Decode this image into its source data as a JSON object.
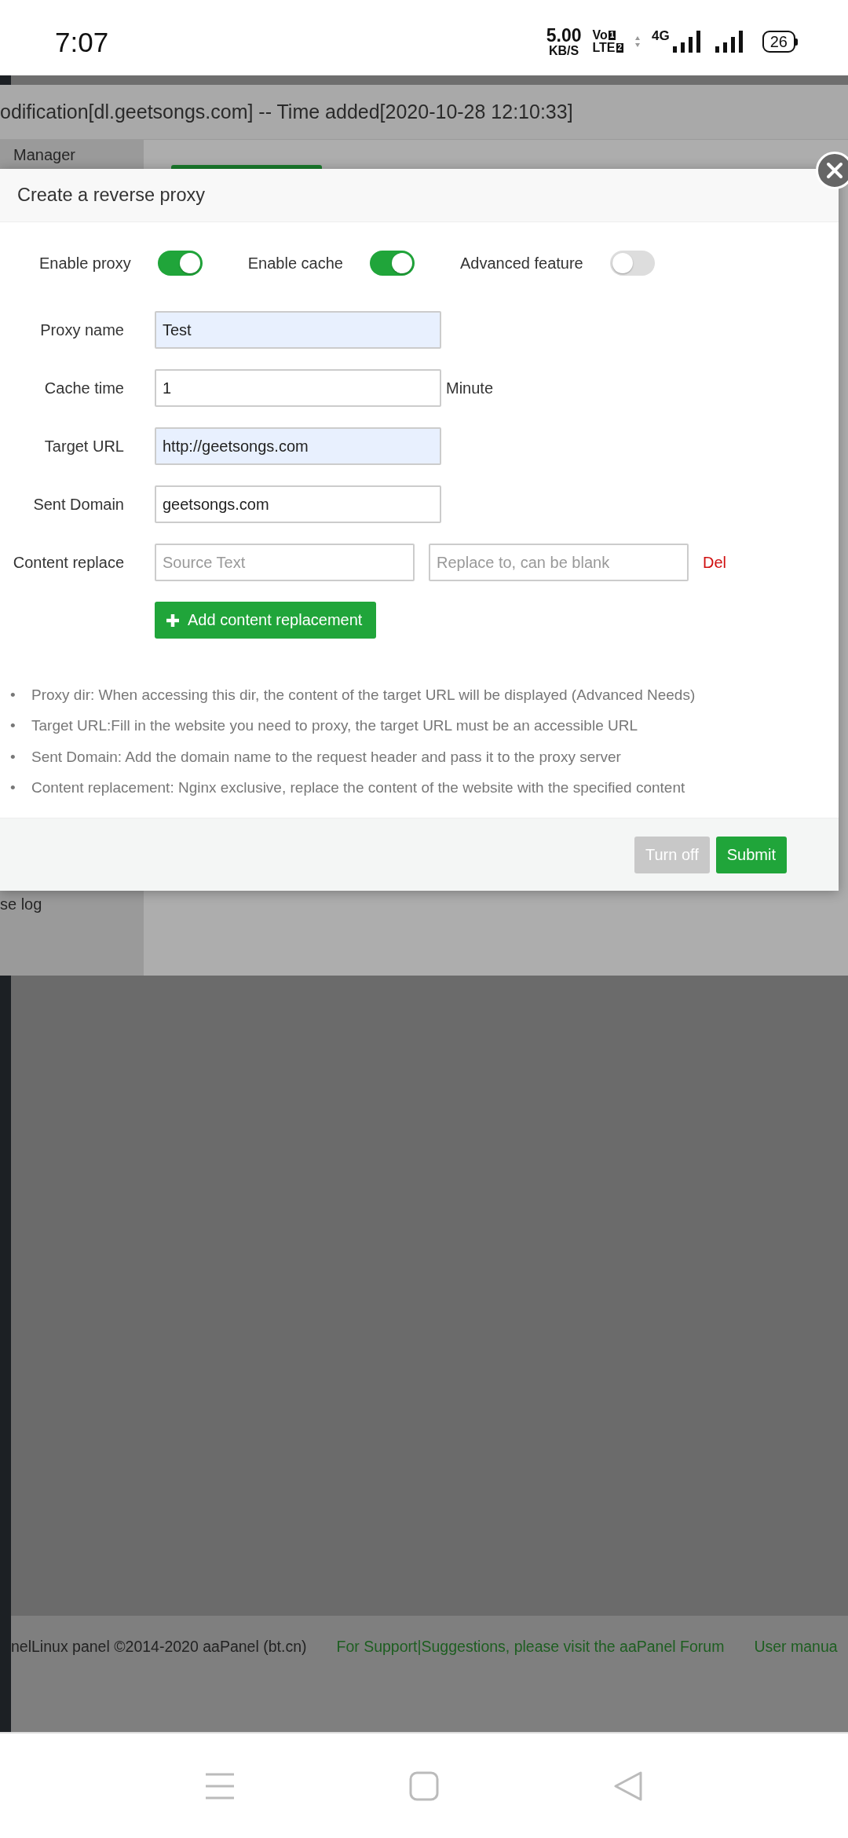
{
  "status_bar": {
    "time": "7:07",
    "speed": "5.00",
    "speed_unit": "KB/S",
    "volte": {
      "line1": "Vo",
      "sim1": "1",
      "line2": "LTE",
      "sim2": "2"
    },
    "network": "4G",
    "battery": "26"
  },
  "background": {
    "header_title": "odification[dl.geetsongs.com] -- Time added[2020-10-28 12:10:33]",
    "sidebar_items": [
      "Manager",
      "se log"
    ],
    "footer": {
      "copyright": "nelLinux panel ©2014-2020 aaPanel (bt.cn)",
      "links": [
        "For Support|Suggestions, please visit the aaPanel Forum",
        "User manua"
      ]
    }
  },
  "modal": {
    "title": "Create a reverse proxy",
    "toggles": [
      {
        "label": "Enable proxy",
        "on": true
      },
      {
        "label": "Enable cache",
        "on": true
      },
      {
        "label": "Advanced feature",
        "on": false
      }
    ],
    "fields": [
      {
        "label": "Proxy name",
        "value": "Test",
        "autofilled": true
      },
      {
        "label": "Cache time",
        "value": "1",
        "suffix": "Minute",
        "autofilled": false
      },
      {
        "label": "Target URL",
        "value": "http://geetsongs.com",
        "autofilled": true
      },
      {
        "label": "Sent Domain",
        "value": "geetsongs.com",
        "autofilled": false
      }
    ],
    "content_replace": {
      "label": "Content replace",
      "source_placeholder": "Source Text",
      "replace_placeholder": "Replace to, can be blank",
      "delete_link": "Del"
    },
    "add_button": "Add content replacement",
    "notes": [
      {
        "bullet": "•",
        "text": "Proxy dir: When accessing this dir, the content of the target URL will be displayed (Advanced Needs)"
      },
      {
        "bullet": "•",
        "text": "Target URL:Fill in the website you need to proxy, the target URL must be an accessible URL"
      },
      {
        "bullet": "•",
        "text": "Sent Domain: Add the domain name to the request header and pass it to the proxy server"
      },
      {
        "bullet": "•",
        "text": "Content replacement: Nginx exclusive, replace the content of the website with the specified content"
      }
    ],
    "buttons": [
      {
        "label": "Turn off",
        "kind": "secondary"
      },
      {
        "label": "Submit",
        "kind": "primary"
      }
    ]
  }
}
